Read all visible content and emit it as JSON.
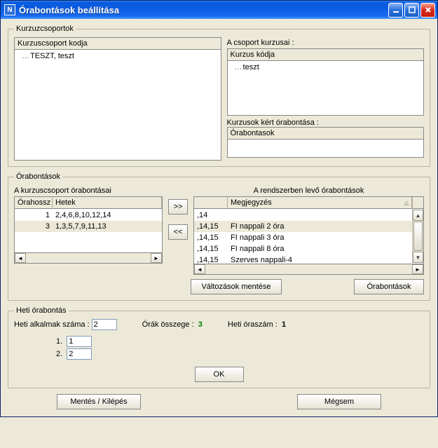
{
  "title": "Órabontások beállítása",
  "group1": {
    "legend": "Kurzuzcsoportok",
    "left_header": "Kurzuscsoport kodja",
    "left_item": "TESZT, teszt",
    "right_top_label": "A csoport kurzusai :",
    "right_top_header": "Kurzus kódja",
    "right_top_item": "teszt",
    "right_bot_label": "Kurzusok kért órabontása :",
    "right_bot_header": "Órabontasok"
  },
  "group2": {
    "legend": "Órabontások",
    "left_label": "A kurzuscsoport órabontásai",
    "left_hdr_col1": "Órahossz",
    "left_hdr_col2": "Hetek",
    "left_rows": [
      {
        "hossz": "1",
        "hetek": "2,4,6,8,10,12,14"
      },
      {
        "hossz": "3",
        "hetek": "1,3,5,7,9,11,13"
      }
    ],
    "btn_right": ">>",
    "btn_left": "<<",
    "right_label": "A rendszerben levő órabontások",
    "right_hdr_col1": "",
    "right_hdr_col2": "Megjegyzés",
    "right_rows": [
      {
        "a": ",14",
        "b": ""
      },
      {
        "a": ",14,15",
        "b": "FI nappali 2 óra"
      },
      {
        "a": ",14,15",
        "b": "FI nappali 3 óra"
      },
      {
        "a": ",14,15",
        "b": "FI nappali 8 óra"
      },
      {
        "a": ",14,15",
        "b": "Szerves nappali-4"
      }
    ],
    "btn_save_changes": "Változások mentése",
    "btn_orabontasok": "Órabontások"
  },
  "group3": {
    "legend": "Heti órabontás",
    "label_alkalmak": "Heti alkalmak száma :",
    "val_alkalmak": "2",
    "label_orak": "Órák összege :",
    "val_orak": "3",
    "label_heti": "Heti óraszám :",
    "val_heti": "1",
    "entry1_label": "1.",
    "entry1_val": "1",
    "entry2_label": "2.",
    "entry2_val": "2",
    "btn_ok": "OK"
  },
  "btn_mentes": "Mentés / Kilépés",
  "btn_megsem": "Mégsem"
}
